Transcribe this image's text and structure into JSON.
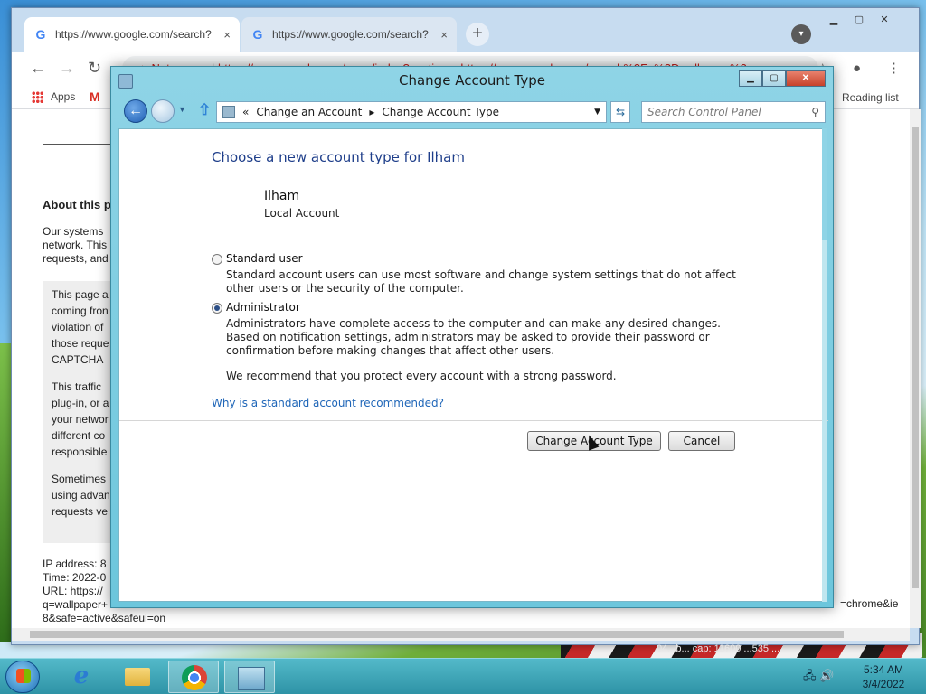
{
  "browser": {
    "tabs": [
      {
        "title": "https://www.google.com/search?",
        "close": "×"
      },
      {
        "title": "https://www.google.com/search?",
        "close": "×"
      }
    ],
    "new_tab": "+",
    "window_controls": {
      "minimize": "▁",
      "maximize": "▢",
      "close": "✕"
    },
    "omnibox": {
      "security": "▲ Not secure",
      "url": "https://www.google.com/sorry/index?continue=https://www.google.com/search%3Fq%3Dwallpaper%2"
    },
    "bookmarks": {
      "apps": "Apps",
      "gmail": "M",
      "reading_list": "Reading list"
    },
    "page": {
      "about_heading": "About this p",
      "para1": "Our systems network. This requests, and",
      "grey1": "This page a coming fron violation of those reque CAPTCHA",
      "grey2": "This traffic plug-in, or a your networ different co responsible",
      "grey3": "Sometimes using advan requests ve",
      "info": "IP address: 8\nTime: 2022-0\nURL: https://\nq=wallpaper+\n8&safe=active&safeui=on",
      "tail": "=chrome&ie"
    }
  },
  "dialog": {
    "title": "Change Account Type",
    "controls": {
      "minimize": "▁",
      "maximize": "▢",
      "close": "✕"
    },
    "breadcrumb": {
      "sep": "«",
      "parent": "Change an Account",
      "arrow": "▸",
      "current": "Change Account Type"
    },
    "search_placeholder": "Search Control Panel",
    "heading": "Choose a new account type for Ilham",
    "user": {
      "name": "Ilham",
      "type": "Local Account"
    },
    "options": [
      {
        "label": "Standard user",
        "selected": false,
        "description": "Standard account users can use most software and change system settings that do not affect other users or the security of the computer."
      },
      {
        "label": "Administrator",
        "selected": true,
        "description": "Administrators have complete access to the computer and can make any desired changes. Based on notification settings, administrators may be asked to provide their password or confirmation before making changes that affect other users."
      }
    ],
    "recommendation": "We recommend that you protect every account with a strong password.",
    "why_link": "Why is a standard account recommended?",
    "buttons": {
      "primary": "Change Account Type",
      "cancel": "Cancel"
    }
  },
  "taskbar": {
    "clock": {
      "time": "5:34 AM",
      "date": "3/4/2022"
    },
    "desktop_caption": "04...b... cap: 11600 ...535 ..."
  }
}
